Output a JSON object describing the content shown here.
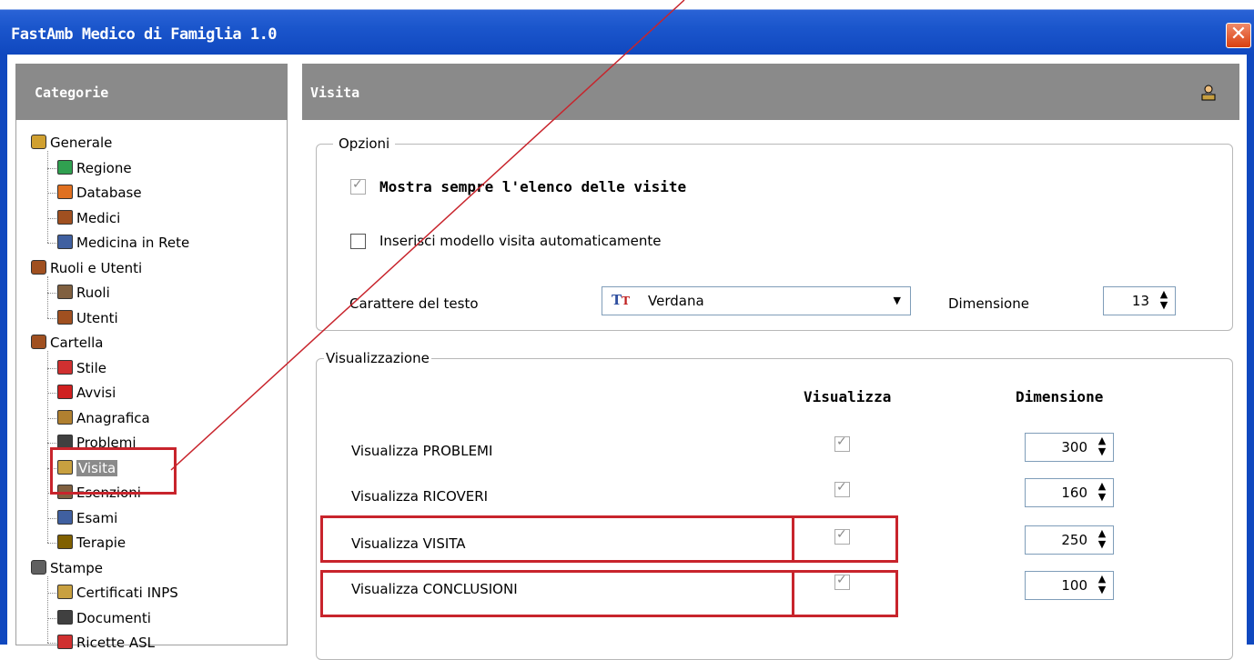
{
  "window": {
    "title": "FastAmb Medico di Famiglia 1.0",
    "close_glyph": "✕"
  },
  "left_panel": {
    "header": "Categorie",
    "tree": [
      {
        "label": "Generale",
        "icon": "generale-icon",
        "level": 0
      },
      {
        "label": "Regione",
        "icon": "regione-icon",
        "level": 1
      },
      {
        "label": "Database",
        "icon": "database-icon",
        "level": 1
      },
      {
        "label": "Medici",
        "icon": "medici-icon",
        "level": 1
      },
      {
        "label": "Medicina in Rete",
        "icon": "medicina-rete-icon",
        "level": 1
      },
      {
        "label": "Ruoli e Utenti",
        "icon": "ruoli-utenti-icon",
        "level": 0
      },
      {
        "label": "Ruoli",
        "icon": "ruoli-icon",
        "level": 1
      },
      {
        "label": "Utenti",
        "icon": "utenti-icon",
        "level": 1
      },
      {
        "label": "Cartella",
        "icon": "cartella-icon",
        "level": 0
      },
      {
        "label": "Stile",
        "icon": "stile-icon",
        "level": 1
      },
      {
        "label": "Avvisi",
        "icon": "avvisi-icon",
        "level": 1
      },
      {
        "label": "Anagrafica",
        "icon": "anagrafica-icon",
        "level": 1
      },
      {
        "label": "Problemi",
        "icon": "problemi-icon",
        "level": 1
      },
      {
        "label": "Visita",
        "icon": "visita-icon",
        "level": 1,
        "selected": true
      },
      {
        "label": "Esenzioni",
        "icon": "esenzioni-icon",
        "level": 1
      },
      {
        "label": "Esami",
        "icon": "esami-icon",
        "level": 1
      },
      {
        "label": "Terapie",
        "icon": "terapie-icon",
        "level": 1
      },
      {
        "label": "Stampe",
        "icon": "stampe-icon",
        "level": 0
      },
      {
        "label": "Certificati INPS",
        "icon": "certificati-icon",
        "level": 1
      },
      {
        "label": "Documenti",
        "icon": "documenti-icon",
        "level": 1
      },
      {
        "label": "Ricette ASL",
        "icon": "ricette-icon",
        "level": 1
      }
    ]
  },
  "main": {
    "header": "Visita",
    "header_icon": "visita-icon",
    "opzioni": {
      "legend": "Opzioni",
      "show_list_label": "Mostra sempre l'elenco delle visite",
      "show_list_checked": true,
      "auto_model_label": "Inserisci modello visita automaticamente",
      "auto_model_checked": false,
      "font_label": "Carattere del testo",
      "font_value": "Verdana",
      "font_icon": "truetype-font-icon",
      "size_label": "Dimensione",
      "size_value": "13"
    },
    "visualizzazione": {
      "legend": "Visualizzazione",
      "col_visualizza": "Visualizza",
      "col_dimensione": "Dimensione",
      "rows": [
        {
          "label": "Visualizza PROBLEMI",
          "checked": true,
          "size": "300"
        },
        {
          "label": "Visualizza RICOVERI",
          "checked": true,
          "size": "160"
        },
        {
          "label": "Visualizza VISITA",
          "checked": true,
          "size": "250"
        },
        {
          "label": "Visualizza CONCLUSIONI",
          "checked": true,
          "size": "100"
        }
      ]
    }
  },
  "colors": {
    "title_bar": "#1048bf",
    "header_gray": "#8a8a8a",
    "annotation_red": "#c8242c"
  }
}
